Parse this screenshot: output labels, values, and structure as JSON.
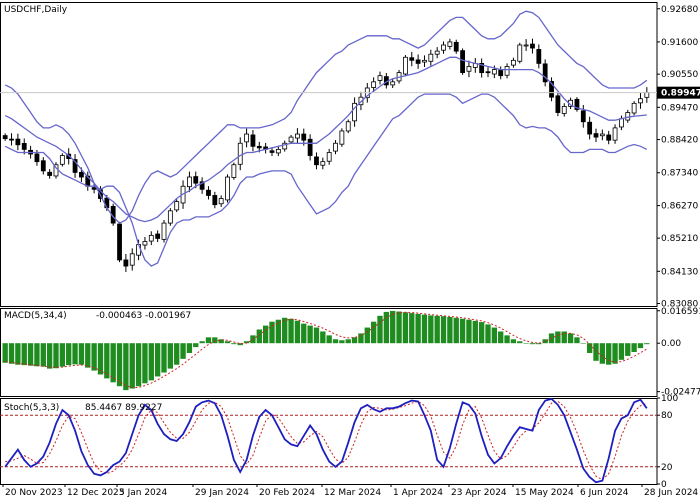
{
  "colors": {
    "background": "#ffffff",
    "axis": "#000000",
    "grid_dash": "#c8c8c8",
    "bollinger": "#6666cc",
    "candle": "#000000",
    "macd_hist": "#1e8c1e",
    "macd_signal": "#cc2222",
    "stoch_main": "#1f1fbf",
    "stoch_signal": "#cc2222",
    "level_line": "#b02020",
    "price_tag_bg": "#000000"
  },
  "chart_data": [
    {
      "type": "candlestick",
      "title": "USDCHF,Daily",
      "indicator": "Bollinger Bands",
      "ylim": [
        0.83,
        0.929
      ],
      "yticks": [
        "0.92680",
        "0.91600",
        "0.90550",
        "0.89947",
        "0.89470",
        "0.88420",
        "0.87340",
        "0.86270",
        "0.85210",
        "0.84130",
        "0.83080"
      ],
      "current_price": "0.89947",
      "x_labels": [
        "20 Nov 2023",
        "12 Dec 2023",
        "5 Jan 2024",
        "29 Jan 2024",
        "20 Feb 2024",
        "12 Mar 2024",
        "1 Apr 2024",
        "23 Apr 2024",
        "15 May 2024",
        "6 Jun 2024",
        "28 Jun 2024"
      ],
      "close": [
        0.8845,
        0.8842,
        0.8825,
        0.881,
        0.8795,
        0.877,
        0.874,
        0.8725,
        0.876,
        0.879,
        0.878,
        0.8735,
        0.872,
        0.869,
        0.868,
        0.865,
        0.862,
        0.857,
        0.845,
        0.843,
        0.847,
        0.85,
        0.851,
        0.853,
        0.852,
        0.857,
        0.861,
        0.864,
        0.869,
        0.872,
        0.87,
        0.868,
        0.866,
        0.863,
        0.865,
        0.872,
        0.876,
        0.883,
        0.886,
        0.882,
        0.8815,
        0.881,
        0.88,
        0.881,
        0.883,
        0.885,
        0.886,
        0.884,
        0.879,
        0.876,
        0.877,
        0.88,
        0.883,
        0.887,
        0.89,
        0.896,
        0.898,
        0.901,
        0.903,
        0.905,
        0.902,
        0.903,
        0.906,
        0.911,
        0.91,
        0.909,
        0.91,
        0.912,
        0.913,
        0.915,
        0.916,
        0.913,
        0.906,
        0.908,
        0.909,
        0.906,
        0.906,
        0.907,
        0.905,
        0.908,
        0.91,
        0.915,
        0.915,
        0.914,
        0.909,
        0.903,
        0.898,
        0.893,
        0.895,
        0.897,
        0.894,
        0.89,
        0.886,
        0.885,
        0.886,
        0.884,
        0.888,
        0.891,
        0.893,
        0.896,
        0.8975,
        0.8995
      ],
      "series": [
        {
          "name": "Bollinger Upper",
          "values": [
            0.902,
            0.901,
            0.899,
            0.896,
            0.893,
            0.89,
            0.888,
            0.888,
            0.889,
            0.888,
            0.886,
            0.883,
            0.879,
            0.875,
            0.87,
            0.866,
            0.862,
            0.859,
            0.857,
            0.858,
            0.861,
            0.866,
            0.87,
            0.873,
            0.874,
            0.873,
            0.872,
            0.873,
            0.875,
            0.877,
            0.879,
            0.881,
            0.883,
            0.885,
            0.887,
            0.889,
            0.889,
            0.888,
            0.888,
            0.888,
            0.888,
            0.8885,
            0.889,
            0.89,
            0.891,
            0.893,
            0.897,
            0.9,
            0.903,
            0.906,
            0.908,
            0.91,
            0.912,
            0.913,
            0.915,
            0.916,
            0.917,
            0.918,
            0.918,
            0.918,
            0.918,
            0.917,
            0.917,
            0.916,
            0.915,
            0.914,
            0.915,
            0.917,
            0.919,
            0.921,
            0.923,
            0.924,
            0.924,
            0.922,
            0.92,
            0.918,
            0.917,
            0.917,
            0.918,
            0.92,
            0.922,
            0.925,
            0.926,
            0.9255,
            0.924,
            0.921,
            0.918,
            0.915,
            0.913,
            0.911,
            0.909,
            0.908,
            0.906,
            0.904,
            0.902,
            0.901,
            0.901,
            0.901,
            0.901,
            0.901,
            0.902,
            0.9035
          ]
        },
        {
          "name": "Bollinger Middle",
          "values": [
            0.892,
            0.891,
            0.8895,
            0.888,
            0.8865,
            0.885,
            0.884,
            0.883,
            0.882,
            0.8805,
            0.879,
            0.877,
            0.8745,
            0.872,
            0.87,
            0.8675,
            0.8655,
            0.864,
            0.862,
            0.86,
            0.859,
            0.858,
            0.8575,
            0.858,
            0.859,
            0.861,
            0.863,
            0.865,
            0.8665,
            0.8675,
            0.869,
            0.87,
            0.871,
            0.8725,
            0.874,
            0.876,
            0.8775,
            0.879,
            0.88,
            0.88,
            0.8805,
            0.881,
            0.8815,
            0.882,
            0.8825,
            0.883,
            0.883,
            0.883,
            0.883,
            0.883,
            0.8845,
            0.886,
            0.888,
            0.89,
            0.892,
            0.8945,
            0.8965,
            0.8985,
            0.9,
            0.9015,
            0.903,
            0.904,
            0.9045,
            0.905,
            0.9055,
            0.906,
            0.907,
            0.908,
            0.909,
            0.91,
            0.911,
            0.911,
            0.91,
            0.9095,
            0.909,
            0.9085,
            0.908,
            0.9075,
            0.907,
            0.907,
            0.907,
            0.907,
            0.907,
            0.907,
            0.906,
            0.9045,
            0.9025,
            0.9,
            0.8975,
            0.8955,
            0.8945,
            0.894,
            0.8935,
            0.8925,
            0.8915,
            0.8905,
            0.8905,
            0.891,
            0.8915,
            0.8918,
            0.892,
            0.8922
          ]
        },
        {
          "name": "Bollinger Lower",
          "values": [
            0.882,
            0.881,
            0.88,
            0.88,
            0.88,
            0.88,
            0.88,
            0.878,
            0.875,
            0.873,
            0.872,
            0.871,
            0.87,
            0.869,
            0.869,
            0.868,
            0.869,
            0.869,
            0.867,
            0.862,
            0.857,
            0.85,
            0.845,
            0.843,
            0.844,
            0.849,
            0.854,
            0.857,
            0.858,
            0.858,
            0.859,
            0.859,
            0.859,
            0.86,
            0.861,
            0.863,
            0.866,
            0.87,
            0.872,
            0.872,
            0.873,
            0.8735,
            0.874,
            0.874,
            0.874,
            0.873,
            0.869,
            0.866,
            0.863,
            0.86,
            0.861,
            0.862,
            0.864,
            0.867,
            0.869,
            0.873,
            0.876,
            0.879,
            0.882,
            0.885,
            0.888,
            0.891,
            0.892,
            0.894,
            0.896,
            0.898,
            0.899,
            0.899,
            0.899,
            0.899,
            0.899,
            0.898,
            0.896,
            0.897,
            0.898,
            0.899,
            0.899,
            0.898,
            0.896,
            0.894,
            0.892,
            0.889,
            0.888,
            0.8885,
            0.888,
            0.888,
            0.887,
            0.885,
            0.882,
            0.88,
            0.88,
            0.88,
            0.881,
            0.881,
            0.881,
            0.88,
            0.88,
            0.881,
            0.882,
            0.8826,
            0.882,
            0.881
          ]
        }
      ]
    },
    {
      "type": "bar",
      "title": "MACD(5,34,4)",
      "values_text": "-0.000463 -0.001967",
      "ylim": [
        -0.027,
        0.018
      ],
      "yticks": [
        "0.016591",
        "0.00",
        "-0.024771"
      ],
      "series": [
        {
          "name": "MACD",
          "values": [
            -0.01,
            -0.0105,
            -0.011,
            -0.0112,
            -0.0115,
            -0.0118,
            -0.012,
            -0.013,
            -0.0128,
            -0.012,
            -0.0112,
            -0.0108,
            -0.011,
            -0.0125,
            -0.014,
            -0.016,
            -0.018,
            -0.02,
            -0.022,
            -0.024,
            -0.0232,
            -0.022,
            -0.0205,
            -0.019,
            -0.017,
            -0.015,
            -0.013,
            -0.011,
            -0.008,
            -0.005,
            -0.002,
            0.001,
            0.003,
            0.003,
            0.002,
            0.001,
            -0.0005,
            -0.001,
            0.001,
            0.004,
            0.007,
            0.009,
            0.011,
            0.012,
            0.013,
            0.0125,
            0.0115,
            0.01,
            0.009,
            0.008,
            0.006,
            0.004,
            0.002,
            0.0015,
            0.002,
            0.003,
            0.005,
            0.008,
            0.011,
            0.014,
            0.016,
            0.0165,
            0.0162,
            0.0158,
            0.0154,
            0.015,
            0.0146,
            0.0142,
            0.014,
            0.0138,
            0.0134,
            0.013,
            0.0125,
            0.012,
            0.0114,
            0.0108,
            0.0096,
            0.008,
            0.006,
            0.004,
            0.002,
            0.001,
            0.0,
            -0.0005,
            -0.0005,
            0.002,
            0.005,
            0.006,
            0.006,
            0.005,
            0.003,
            0.0,
            -0.005,
            -0.009,
            -0.0105,
            -0.011,
            -0.0105,
            -0.0085,
            -0.0065,
            -0.0045,
            -0.0025,
            -0.0005
          ]
        },
        {
          "name": "Signal",
          "values": [
            -0.0095,
            -0.0099,
            -0.0103,
            -0.0107,
            -0.011,
            -0.0114,
            -0.0117,
            -0.0121,
            -0.0124,
            -0.0122,
            -0.0117,
            -0.0113,
            -0.0111,
            -0.0116,
            -0.0125,
            -0.014,
            -0.0157,
            -0.0176,
            -0.0197,
            -0.0217,
            -0.0227,
            -0.0226,
            -0.0217,
            -0.0204,
            -0.0188,
            -0.0169,
            -0.015,
            -0.013,
            -0.0107,
            -0.0082,
            -0.0057,
            -0.003,
            -0.0006,
            0.001,
            0.0017,
            0.0015,
            0.0006,
            -0.0002,
            0.0001,
            0.0019,
            0.0043,
            0.0066,
            0.0088,
            0.0104,
            0.0117,
            0.0122,
            0.012,
            0.0111,
            0.0101,
            0.009,
            0.0077,
            0.0062,
            0.0045,
            0.0032,
            0.0027,
            0.0029,
            0.0039,
            0.0058,
            0.0081,
            0.0106,
            0.0131,
            0.0148,
            0.0156,
            0.0158,
            0.0157,
            0.0154,
            0.015,
            0.0146,
            0.0143,
            0.014,
            0.0137,
            0.0134,
            0.013,
            0.0125,
            0.0119,
            0.0114,
            0.0105,
            0.0093,
            0.0077,
            0.0059,
            0.004,
            0.0024,
            0.0012,
            0.0004,
            0.0,
            0.0008,
            0.0026,
            0.004,
            0.005,
            0.005,
            0.0043,
            0.0025,
            -0.0005,
            -0.0039,
            -0.0069,
            -0.0088,
            -0.0097,
            -0.0094,
            -0.0082,
            -0.0067,
            -0.0048,
            -0.003
          ]
        }
      ]
    },
    {
      "type": "line",
      "title": "Stoch(5,3,3)",
      "values_text": "85.4467 89.9227",
      "ylim": [
        0,
        100
      ],
      "yticks": [
        "100",
        "80",
        "20",
        "0"
      ],
      "levels": [
        80,
        20
      ],
      "series": [
        {
          "name": "%K",
          "values": [
            20,
            30,
            40,
            28,
            20,
            24,
            32,
            48,
            70,
            86,
            80,
            62,
            38,
            22,
            12,
            10,
            14,
            22,
            26,
            36,
            58,
            80,
            92,
            86,
            70,
            58,
            52,
            50,
            58,
            72,
            90,
            95,
            97,
            94,
            80,
            56,
            28,
            14,
            28,
            56,
            78,
            86,
            80,
            66,
            52,
            46,
            44,
            56,
            68,
            58,
            40,
            26,
            20,
            26,
            48,
            72,
            88,
            92,
            87,
            84,
            88,
            88,
            90,
            94,
            97,
            96,
            80,
            62,
            28,
            20,
            42,
            70,
            95,
            92,
            82,
            56,
            34,
            24,
            30,
            44,
            56,
            66,
            64,
            62,
            86,
            97,
            99,
            92,
            80,
            60,
            40,
            18,
            8,
            2,
            4,
            30,
            62,
            76,
            80,
            95,
            98,
            88
          ]
        },
        {
          "name": "%D",
          "values": [
            26,
            27,
            30,
            33,
            29,
            24,
            25,
            35,
            50,
            68,
            79,
            76,
            60,
            41,
            24,
            15,
            12,
            15,
            21,
            28,
            40,
            58,
            77,
            86,
            83,
            71,
            60,
            53,
            53,
            60,
            73,
            86,
            94,
            95,
            90,
            77,
            55,
            33,
            23,
            33,
            54,
            73,
            81,
            77,
            66,
            55,
            47,
            49,
            56,
            61,
            55,
            41,
            29,
            24,
            31,
            49,
            69,
            84,
            89,
            88,
            86,
            87,
            89,
            91,
            94,
            96,
            91,
            79,
            57,
            37,
            30,
            44,
            69,
            86,
            90,
            77,
            57,
            38,
            29,
            33,
            43,
            55,
            62,
            64,
            71,
            82,
            94,
            96,
            90,
            77,
            60,
            39,
            22,
            9,
            5,
            12,
            32,
            56,
            73,
            84,
            91,
            94
          ]
        }
      ]
    }
  ]
}
